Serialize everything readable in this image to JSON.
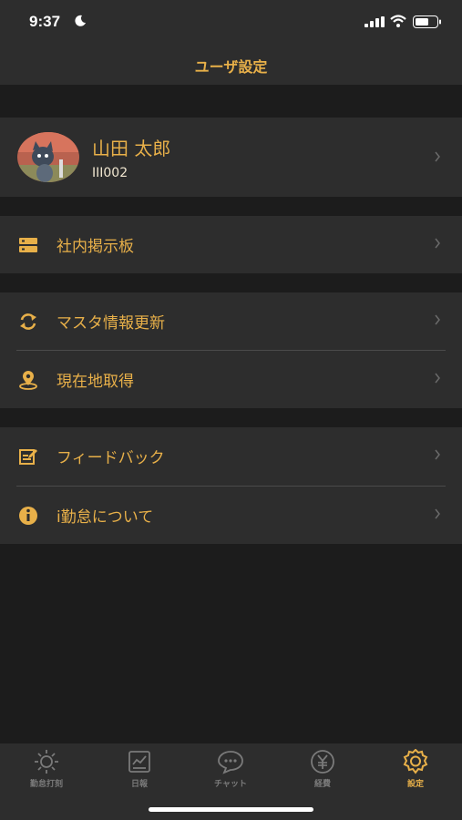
{
  "status_bar": {
    "time": "9:37",
    "icons": [
      "moon-icon",
      "cellular-signal-icon",
      "wifi-icon",
      "battery-icon"
    ]
  },
  "header": {
    "title": "ユーザ設定"
  },
  "profile": {
    "name": "山田 太郎",
    "id": "III002",
    "avatar_icon": "avatar"
  },
  "menu": {
    "bulletin": {
      "label": "社内掲示板",
      "icon": "bulletin-board-icon"
    },
    "master_update": {
      "label": "マスタ情報更新",
      "icon": "refresh-icon"
    },
    "location": {
      "label": "現在地取得",
      "icon": "location-pin-icon"
    },
    "feedback": {
      "label": "フィードバック",
      "icon": "edit-icon"
    },
    "about": {
      "label": "i勤怠について",
      "icon": "info-icon"
    }
  },
  "tabs": [
    {
      "label": "勤怠打刻",
      "icon": "sun-icon",
      "active": false
    },
    {
      "label": "日報",
      "icon": "chart-icon",
      "active": false
    },
    {
      "label": "チャット",
      "icon": "chat-icon",
      "active": false
    },
    {
      "label": "経費",
      "icon": "yen-icon",
      "active": false
    },
    {
      "label": "設定",
      "icon": "gear-icon",
      "active": true
    }
  ],
  "colors": {
    "accent": "#e8b049",
    "background": "#1c1c1c",
    "surface": "#2d2d2d",
    "inactive": "#7a7a7a"
  }
}
